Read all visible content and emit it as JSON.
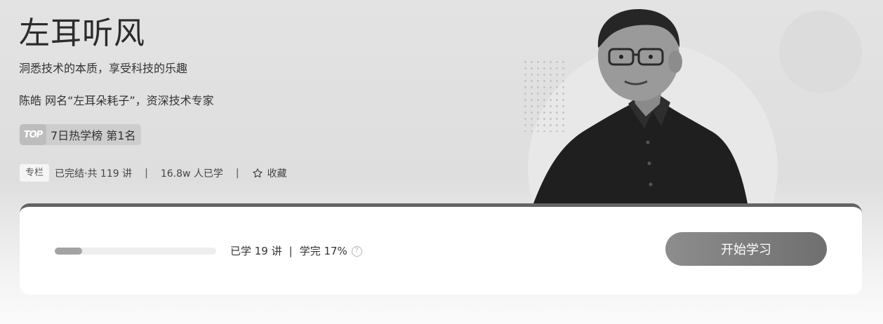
{
  "course": {
    "title": "左耳听风",
    "subtitle": "洞悉技术的本质，享受科技的乐趣",
    "author": "陈皓  网名“左耳朵耗子”，资深技术专家",
    "rank_badge": "TOP",
    "rank_text": "7日热学榜 第1名"
  },
  "meta": {
    "tag": "专栏",
    "status": "已完结·共 119 讲",
    "learners": "16.8w 人已学",
    "favorite_label": "收藏",
    "separator": "|"
  },
  "progress": {
    "fraction": 0.17,
    "learned_text": "已学 19 讲",
    "separator": "|",
    "completed_text": "学完 17%",
    "help_glyph": "?"
  },
  "actions": {
    "start_label": "开始学习"
  },
  "colors": {
    "card_top_border": "#646464",
    "button_start": "#8d8d8d",
    "button_end": "#6f6f6f"
  },
  "icons": {
    "favorite": "star-outline-icon",
    "help": "question-circle-icon",
    "rank": "top-badge-icon"
  }
}
